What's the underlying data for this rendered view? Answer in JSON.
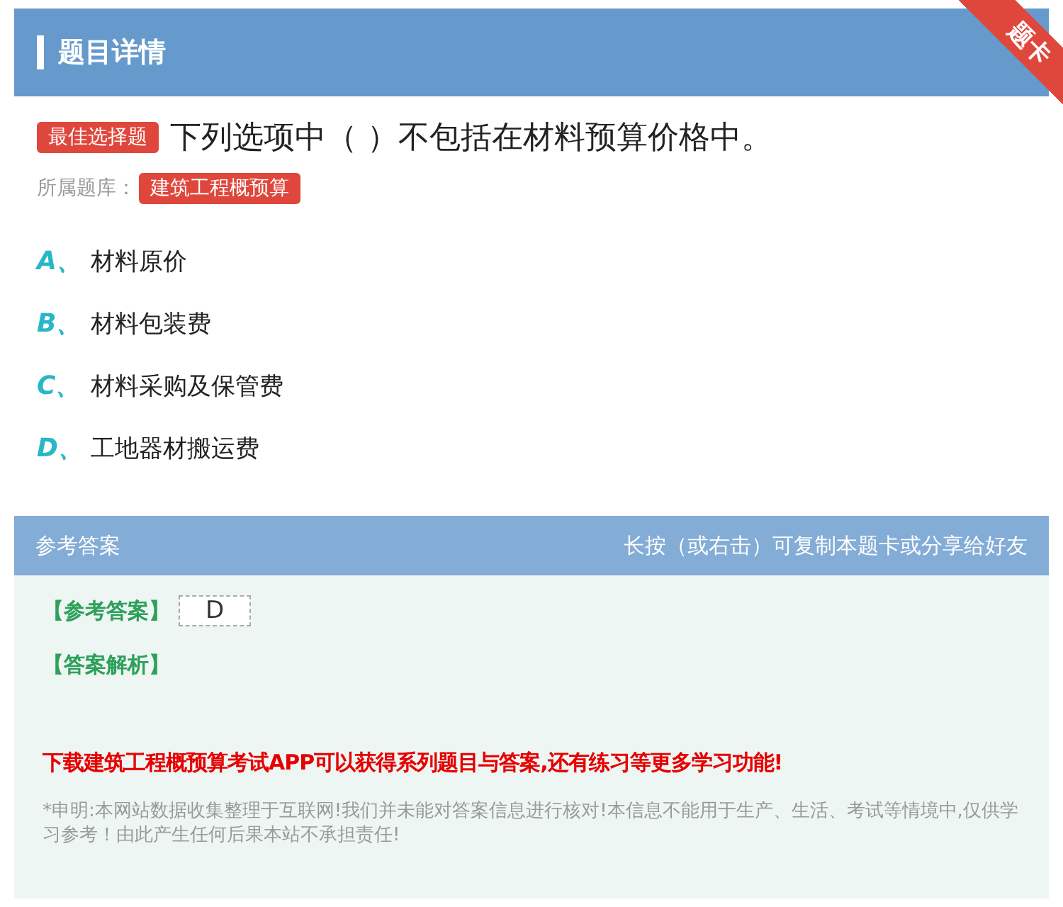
{
  "header": {
    "title": "题目详情",
    "ribbon": "题卡"
  },
  "question": {
    "type_tag": "最佳选择题",
    "text": "下列选项中（ ）不包括在材料预算价格中。",
    "bank_label": "所属题库：",
    "bank_tag": "建筑工程概预算"
  },
  "options": [
    {
      "letter": "A、",
      "text": "材料原价"
    },
    {
      "letter": "B、",
      "text": "材料包装费"
    },
    {
      "letter": "C、",
      "text": "材料采购及保管费"
    },
    {
      "letter": "D、",
      "text": "工地器材搬运费"
    }
  ],
  "answer_panel": {
    "title": "参考答案",
    "hint": "长按（或右击）可复制本题卡或分享给好友",
    "answer_label": "【参考答案】",
    "answer": "D",
    "analysis_label": "【答案解析】",
    "promo": "下载建筑工程概预算考试APP可以获得系列题目与答案,还有练习等更多学习功能!",
    "disclaimer": "*申明:本网站数据收集整理于互联网!我们并未能对答案信息进行核对!本信息不能用于生产、生活、考试等情境中,仅供学习参考！由此产生任何后果本站不承担责任!"
  }
}
